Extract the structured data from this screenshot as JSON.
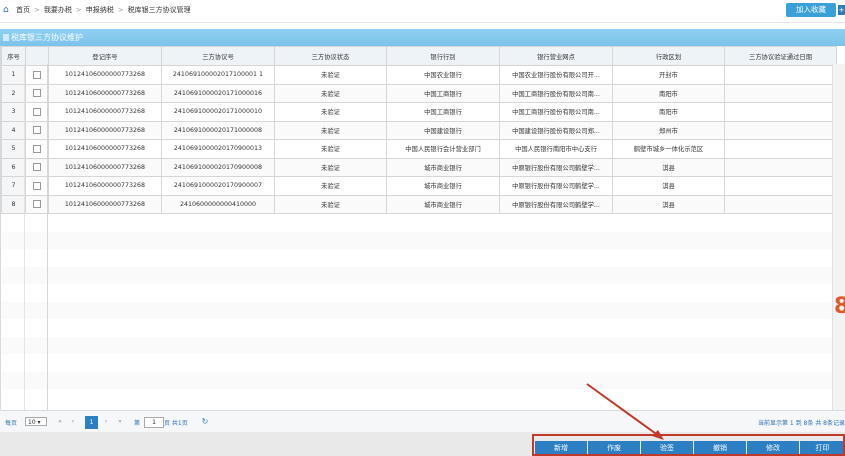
{
  "breadcrumb": [
    "首页",
    "我要办税",
    "申报纳税",
    "税库银三方协议管理"
  ],
  "join_button": "加入收藏",
  "panel_title": "税库银三方协议维护",
  "columns": [
    "序号",
    "",
    "登记序号",
    "三方协议号",
    "三方协议状态",
    "银行行别",
    "银行营业网点",
    "行政区划",
    "三方协议验证通过日期"
  ],
  "rows": [
    [
      "1",
      "10124106000000773268",
      "241069100002017100001 1",
      "未验证",
      "中国农业银行",
      "中国农业银行股份有限公司开...",
      "开封市",
      ""
    ],
    [
      "2",
      "10124106000000773268",
      "2410691000020171000016",
      "未验证",
      "中国工商银行",
      "中国工商银行股份有限公司南...",
      "南阳市",
      ""
    ],
    [
      "3",
      "10124106000000773268",
      "2410691000020171000010",
      "未验证",
      "中国工商银行",
      "中国工商银行股份有限公司南...",
      "南阳市",
      ""
    ],
    [
      "4",
      "10124106000000773268",
      "2410691000020171000008",
      "未验证",
      "中国建设银行",
      "中国建设银行股份有限公司郑...",
      "郑州市",
      ""
    ],
    [
      "5",
      "10124106000000773268",
      "2410691000020170900013",
      "未验证",
      "中国人民银行会计营业部门",
      "中国人民银行南阳市中心支行",
      "鹤壁市城乡一体化示范区",
      ""
    ],
    [
      "6",
      "10124106000000773268",
      "2410691000020170900008",
      "未验证",
      "城市商业银行",
      "中原银行股份有限公司鹤壁学...",
      "淇县",
      ""
    ],
    [
      "7",
      "10124106000000773268",
      "2410691000020170900007",
      "未验证",
      "城市商业银行",
      "中原银行股份有限公司鹤壁学...",
      "淇县",
      ""
    ],
    [
      "8",
      "10124106000000773268",
      "2410600000000410000",
      "未验证",
      "城市商业银行",
      "中原银行股份有限公司鹤壁学...",
      "淇县",
      ""
    ]
  ],
  "pager": {
    "per_page_label": "每页",
    "per_page": "10",
    "page_prefix": "第",
    "page_value": "1",
    "page_suffix": "页 共1页",
    "current": "1",
    "info": "当前显示第 1 到 8条  共 8条记录"
  },
  "actions": [
    "新增",
    "作废",
    "验签",
    "撤销",
    "修改",
    "打印"
  ],
  "colors": {
    "accent": "#2b7fc2",
    "header": "#8fd0f2",
    "annotation": "#c0392b"
  }
}
